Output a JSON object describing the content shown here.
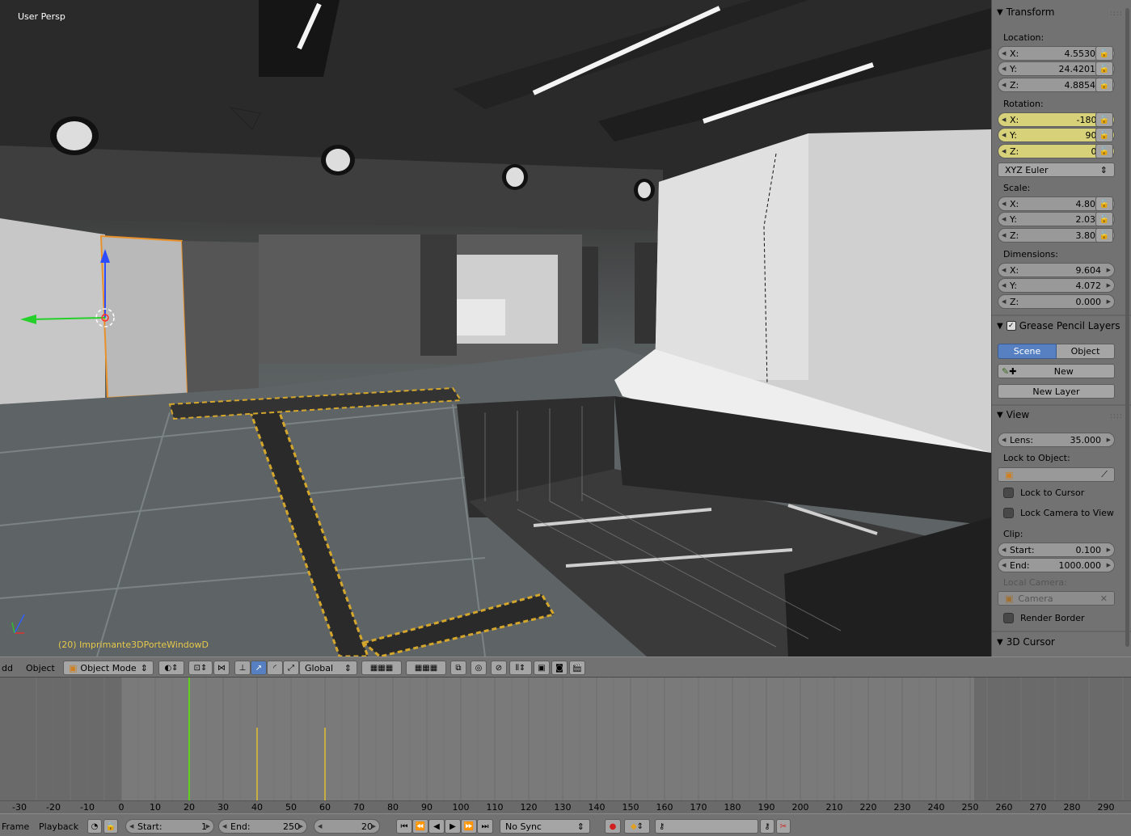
{
  "viewport": {
    "title": "User Persp",
    "object_label": "(20) Imprimante3DPorteWindowD"
  },
  "panel": {
    "transform": {
      "header": "Transform",
      "location_label": "Location:",
      "location": [
        {
          "axis": "X:",
          "value": "4.55306"
        },
        {
          "axis": "Y:",
          "value": "24.42013"
        },
        {
          "axis": "Z:",
          "value": "4.88544"
        }
      ],
      "rotation_label": "Rotation:",
      "rotation": [
        {
          "axis": "X:",
          "value": "-180°"
        },
        {
          "axis": "Y:",
          "value": "90°"
        },
        {
          "axis": "Z:",
          "value": "0°"
        }
      ],
      "rotation_mode": "XYZ Euler",
      "scale_label": "Scale:",
      "scale": [
        {
          "axis": "X:",
          "value": "4.802"
        },
        {
          "axis": "Y:",
          "value": "2.036"
        },
        {
          "axis": "Z:",
          "value": "3.800"
        }
      ],
      "dimensions_label": "Dimensions:",
      "dimensions": [
        {
          "axis": "X:",
          "value": "9.604"
        },
        {
          "axis": "Y:",
          "value": "4.072"
        },
        {
          "axis": "Z:",
          "value": "0.000"
        }
      ]
    },
    "grease": {
      "header": "Grease Pencil Layers",
      "tab_scene": "Scene",
      "tab_object": "Object",
      "new_label": "New",
      "new_layer_label": "New Layer"
    },
    "view": {
      "header": "View",
      "lens_label": "Lens:",
      "lens_value": "35.000",
      "lock_to_object_label": "Lock to Object:",
      "lock_to_cursor": "Lock to Cursor",
      "lock_camera_to_view": "Lock Camera to View",
      "clip_label": "Clip:",
      "clip_start_label": "Start:",
      "clip_start_value": "0.100",
      "clip_end_label": "End:",
      "clip_end_value": "1000.000",
      "local_camera_label": "Local Camera:",
      "camera_value": "Camera",
      "render_border": "Render Border"
    },
    "cursor": {
      "header": "3D Cursor"
    }
  },
  "header3d": {
    "add": "dd",
    "object_menu": "Object",
    "mode": "Object Mode",
    "orientation": "Global"
  },
  "timeline": {
    "ticks": [
      "-30",
      "-20",
      "-10",
      "0",
      "10",
      "20",
      "30",
      "40",
      "50",
      "60",
      "70",
      "80",
      "90",
      "100",
      "110",
      "120",
      "130",
      "140",
      "150",
      "160",
      "170",
      "180",
      "190",
      "200",
      "210",
      "220",
      "230",
      "240",
      "250",
      "260",
      "270",
      "280",
      "290"
    ],
    "current_frame_value": 20,
    "keyframes": [
      40,
      60
    ],
    "start": 0,
    "end": 250
  },
  "timeline_header": {
    "frame_menu": "Frame",
    "playback_menu": "Playback",
    "start_label": "Start:",
    "start_value": "1",
    "end_label": "End:",
    "end_value": "250",
    "current_frame": "20",
    "sync": "No Sync"
  },
  "colors": {
    "accent_selected": "#5680c2",
    "highlight_field": "#d7d27a",
    "playhead": "#60d020",
    "keyframe": "#e0c030",
    "object_label": "#e6c84a"
  }
}
